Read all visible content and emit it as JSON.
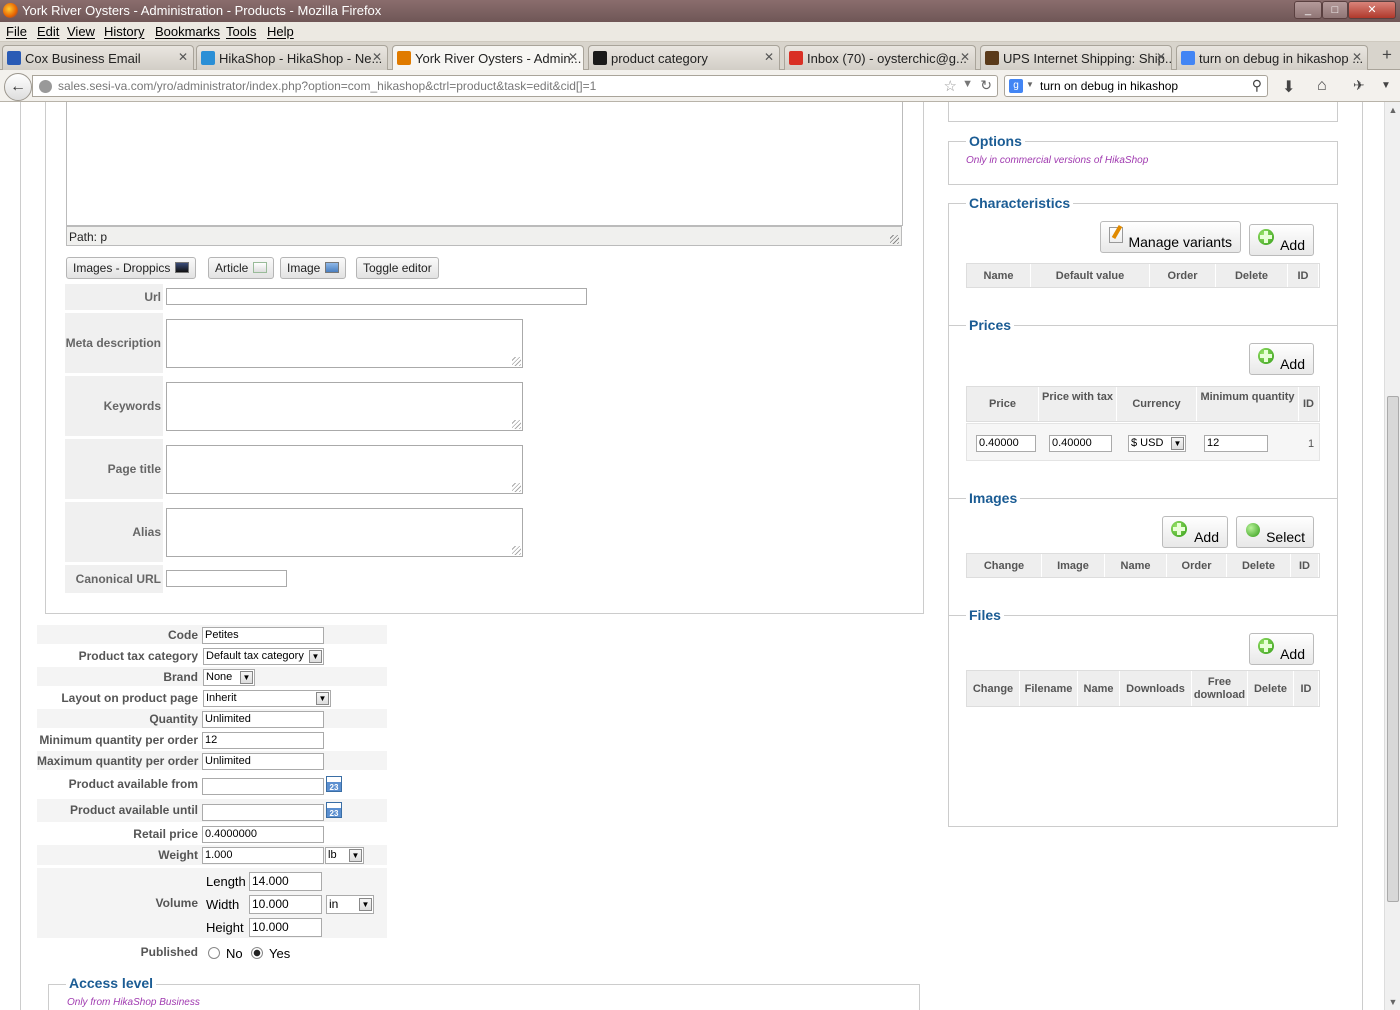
{
  "window": {
    "title": "York River Oysters - Administration - Products - Mozilla Firefox",
    "min": "_",
    "max": "□",
    "close": "✕"
  },
  "menu": [
    "File",
    "Edit",
    "View",
    "History",
    "Bookmarks",
    "Tools",
    "Help"
  ],
  "tabs": [
    {
      "label": "Cox Business Email",
      "icon_color": "#2a5bb5"
    },
    {
      "label": "HikaShop - HikaShop - Ne...",
      "icon_color": "#2a8fd6"
    },
    {
      "label": "York River Oysters - Admin...",
      "icon_color": "#e07b00",
      "active": true
    },
    {
      "label": "product category",
      "icon_color": "#1a1a1a"
    },
    {
      "label": "Inbox (70) - oysterchic@g...",
      "icon_color": "#d93025"
    },
    {
      "label": "UPS Internet Shipping: Ship...",
      "icon_color": "#5a3a1a"
    },
    {
      "label": "turn on debug in hikashop ...",
      "icon_color": "#4285f4"
    }
  ],
  "nav": {
    "url": "sales.sesi-va.com/yro/administrator/index.php?option=com_hikashop&ctrl=product&task=edit&cid[]=1",
    "search_value": "turn on debug in hikashop",
    "search_engine": "g"
  },
  "editor": {
    "path": "Path: p",
    "buttons": [
      "Images - Droppics",
      "Article",
      "Image",
      "Toggle editor"
    ]
  },
  "seo": {
    "url_label": "Url",
    "meta_label": "Meta description",
    "keywords_label": "Keywords",
    "page_title_label": "Page title",
    "alias_label": "Alias",
    "canonical_label": "Canonical URL"
  },
  "product": {
    "code_label": "Code",
    "code": "Petites",
    "tax_label": "Product tax category",
    "tax": "Default tax category",
    "brand_label": "Brand",
    "brand": "None",
    "layout_label": "Layout on product page",
    "layout": "Inherit",
    "quantity_label": "Quantity",
    "quantity": "Unlimited",
    "min_qty_label": "Minimum quantity per order",
    "min_qty": "12",
    "max_qty_label": "Maximum quantity per order",
    "max_qty": "Unlimited",
    "avail_from_label": "Product available from",
    "avail_until_label": "Product available until",
    "retail_label": "Retail price",
    "retail": "0.4000000",
    "weight_label": "Weight",
    "weight": "1.000",
    "weight_unit": "lb",
    "volume_label": "Volume",
    "length_label": "Length",
    "length": "14.000",
    "width_label": "Width",
    "width": "10.000",
    "height_label": "Height",
    "height": "10.000",
    "dim_unit": "in",
    "published_label": "Published",
    "no_label": "No",
    "yes_label": "Yes",
    "published": "Yes",
    "cal_text": "23"
  },
  "access": {
    "title": "Access level",
    "note": "Only from HikaShop Business"
  },
  "options": {
    "title": "Options",
    "note": "Only in commercial versions of HikaShop"
  },
  "characteristics": {
    "title": "Characteristics",
    "manage_label": "Manage variants",
    "add_label": "Add",
    "columns": [
      "Name",
      "Default value",
      "Order",
      "Delete",
      "ID"
    ]
  },
  "prices": {
    "title": "Prices",
    "add_label": "Add",
    "columns": [
      "Price",
      "Price with tax",
      "Currency",
      "Minimum quantity",
      "ID"
    ],
    "rows": [
      {
        "price": "0.40000",
        "price_tax": "0.40000",
        "currency": "$ USD",
        "min_qty": "12",
        "id": "1"
      }
    ]
  },
  "images": {
    "title": "Images",
    "add_label": "Add",
    "select_label": "Select",
    "columns": [
      "Change",
      "Image",
      "Name",
      "Order",
      "Delete",
      "ID"
    ]
  },
  "files": {
    "title": "Files",
    "add_label": "Add",
    "columns": [
      "Change",
      "Filename",
      "Name",
      "Downloads",
      "Free download",
      "ID"
    ]
  }
}
